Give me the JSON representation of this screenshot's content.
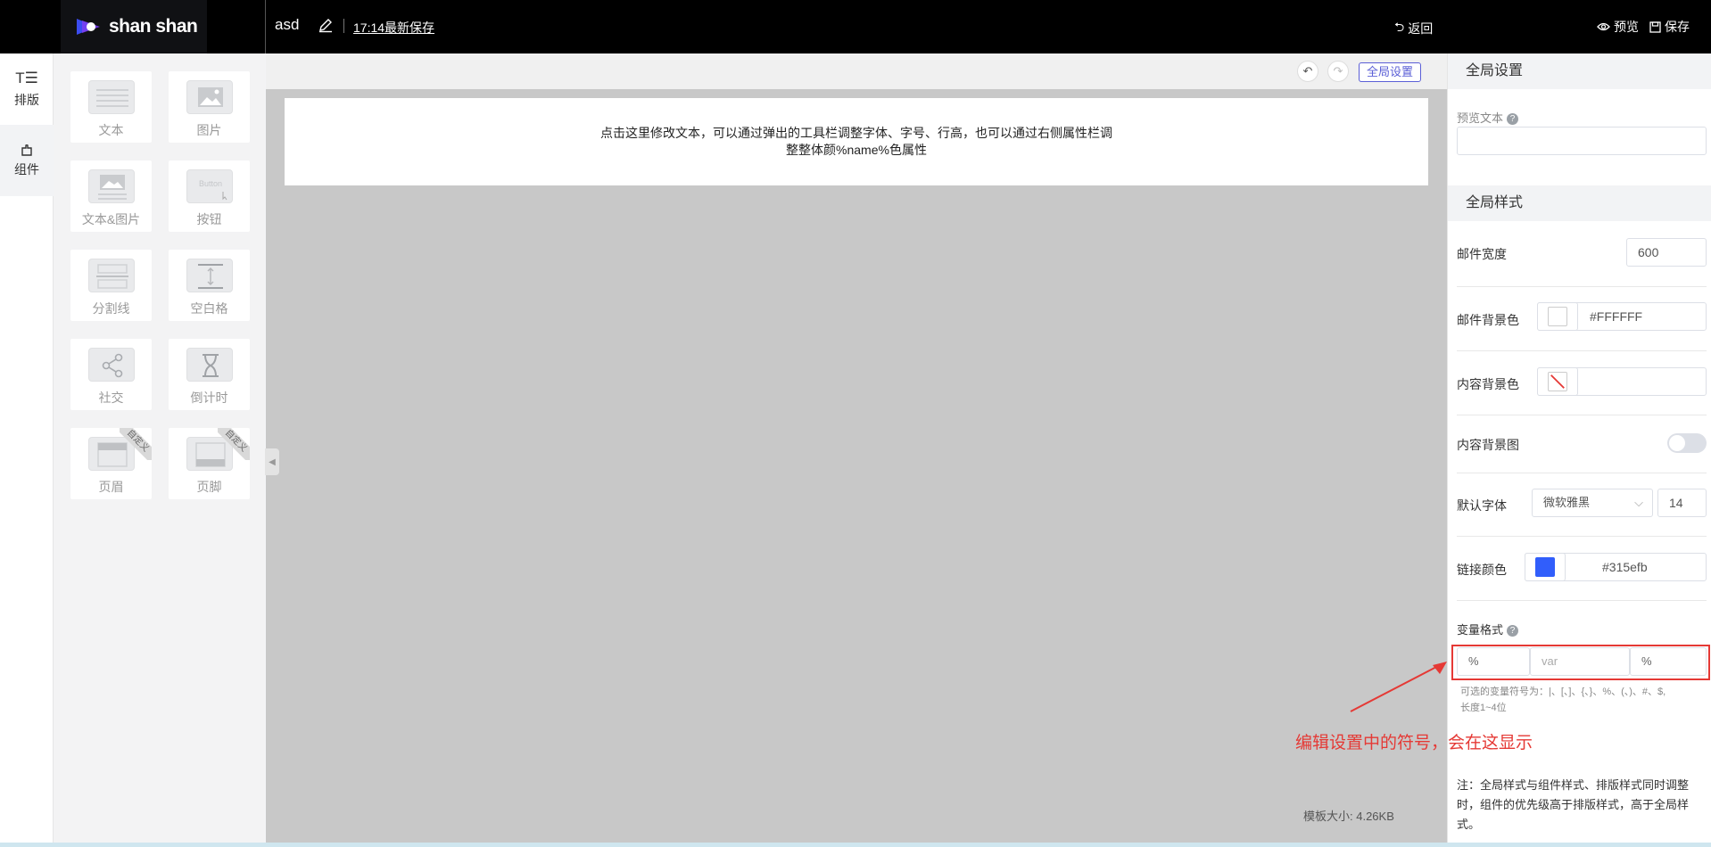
{
  "topbar": {
    "logo_text": "shan shan",
    "doc_title": "asd",
    "save_time": "17:14最新保存",
    "back_label": "返回",
    "preview_label": "预览",
    "save_label": "保存"
  },
  "rail": {
    "items": [
      {
        "label": "排版",
        "icon": "layout-icon"
      },
      {
        "label": "组件",
        "icon": "component-icon"
      }
    ]
  },
  "components": [
    {
      "label": "文本",
      "icon": "text-block-icon"
    },
    {
      "label": "图片",
      "icon": "image-icon"
    },
    {
      "label": "文本&图片",
      "icon": "text-image-icon"
    },
    {
      "label": "按钮",
      "icon": "button-icon",
      "thumb_text": "Button"
    },
    {
      "label": "分割线",
      "icon": "divider-icon"
    },
    {
      "label": "空白格",
      "icon": "spacer-icon"
    },
    {
      "label": "社交",
      "icon": "share-icon"
    },
    {
      "label": "倒计时",
      "icon": "hourglass-icon"
    },
    {
      "label": "页眉",
      "icon": "header-icon",
      "ribbon": "自定义"
    },
    {
      "label": "页脚",
      "icon": "footer-icon",
      "ribbon": "自定义"
    }
  ],
  "canvas": {
    "global_settings_label": "全局设置",
    "email_text_line1": "点击这里修改文本，可以通过弹出的工具栏调整字体、字号、行高，也可以通过右侧属性栏调",
    "email_text_line2": "整整体颜%name%色属性",
    "template_size": "模板大小: 4.26KB"
  },
  "right_panel": {
    "global_settings_header": "全局设置",
    "preview_text_label": "预览文本",
    "preview_text_value": "",
    "global_style_header": "全局样式",
    "mail_width_label": "邮件宽度",
    "mail_width_value": "600",
    "mail_bg_label": "邮件背景色",
    "mail_bg_value": "#FFFFFF",
    "content_bg_label": "内容背景色",
    "content_bg_value": "",
    "content_bg_image_label": "内容背景图",
    "content_bg_image_enabled": false,
    "default_font_label": "默认字体",
    "default_font_value": "微软雅黑",
    "default_font_size": "14",
    "link_color_label": "链接颜色",
    "link_color_value": "#315efb",
    "var_format_label": "变量格式",
    "var_prefix": "%",
    "var_placeholder": "var",
    "var_suffix": "%",
    "var_hint_line1": "可选的变量符号为：|、[、]、{、}、%、(、)、#、$,",
    "var_hint_line2": "长度1~4位",
    "note": "注：全局样式与组件样式、排版样式同时调整时，组件的优先级高于排版样式，高于全局样式。"
  },
  "annotation": {
    "text": "编辑设置中的符号，会在这显示"
  },
  "colors": {
    "accent": "#5b5fd6",
    "link_swatch": "#315efb",
    "annotation_red": "#e53935"
  }
}
